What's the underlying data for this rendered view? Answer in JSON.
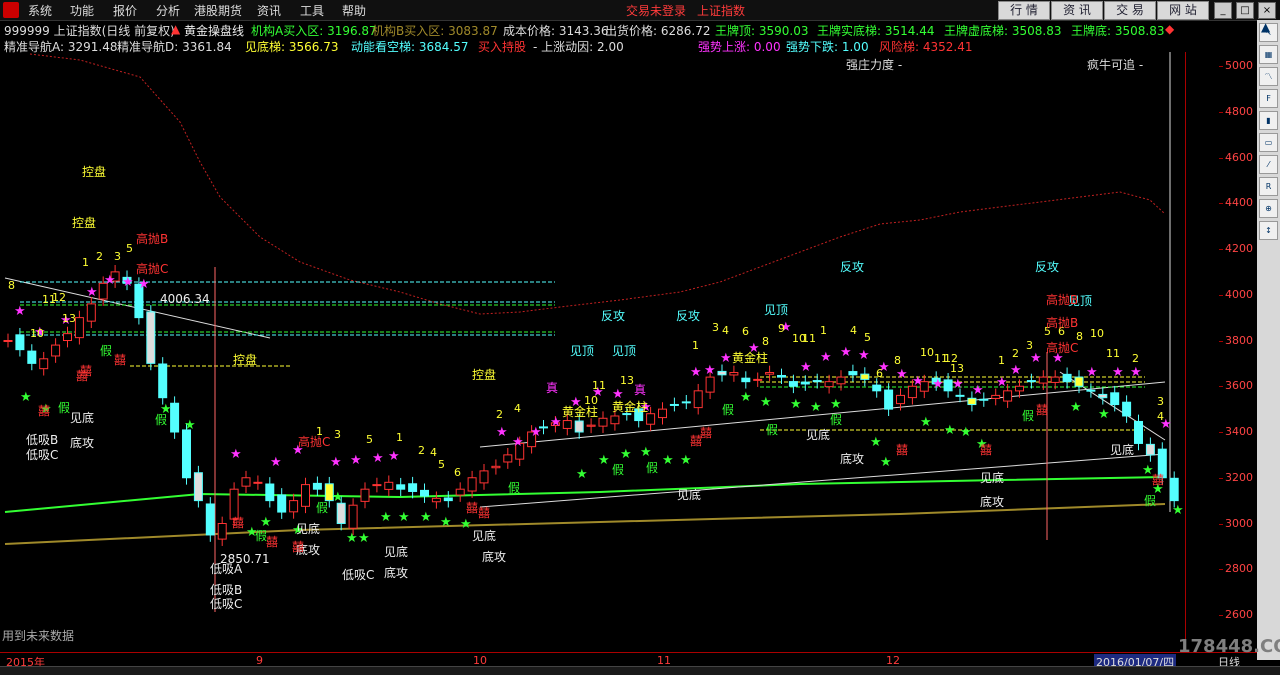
{
  "menu": {
    "items": [
      "系统",
      "功能",
      "报价",
      "分析",
      "港股期货",
      "资讯",
      "工具",
      "帮助"
    ],
    "login_status": "交易未登录",
    "index_name": "上证指数"
  },
  "toolbar_buttons": [
    "行 情",
    "资 讯",
    "交 易",
    "网 站"
  ],
  "header1": {
    "code": "999999 上证指数(日线 前复权)",
    "indicator": "黄金操盘线",
    "inst_a": "机构A买入区: 3196.87",
    "inst_b": "机构B买入区: 3083.87",
    "cost": "成本价格: 3143.36",
    "ship": "出货价格: 6286.72",
    "king_top": "王牌顶: 3590.03",
    "king_real": "王牌实底梯: 3514.44",
    "king_virtual": "王牌虚底梯: 3508.83",
    "king_bottom": "王牌底: 3508.83"
  },
  "header2": {
    "nav_a": "精准导航A: 3291.48",
    "nav_d": "精准导航D: 3361.84",
    "see_bottom": "见底梯: 3566.73",
    "momentum": "动能看空梯: 3684.57",
    "buy_hold": "买入持股",
    "up_factor": "- 上涨动因: 2.00",
    "strong_up": "强势上涨: 0.00",
    "strong_down": "强势下跌: 1.00",
    "risk": "风险梯: 4352.41",
    "strong_force": "强庄力度  -",
    "crazy_bull": "疯牛可追  -"
  },
  "y_axis": [
    "5000",
    "4800",
    "4600",
    "4400",
    "4200",
    "4000",
    "3800",
    "3600",
    "3400",
    "3200",
    "3000",
    "2800",
    "2600"
  ],
  "x_axis": {
    "labels": [
      "2015年",
      "9",
      "10",
      "11",
      "12"
    ],
    "date": "2016/01/07/四",
    "period": "日线"
  },
  "footer_note": "用到未来数据",
  "watermark": "178448.COM",
  "chart_labels": {
    "kongpan": "控盘",
    "low_a": "低吸A",
    "low_b": "低吸B",
    "low_c": "低吸C",
    "see_bottom": "见底",
    "bottom_attack": "底攻",
    "counter_attack": "反攻",
    "see_top": "见顶",
    "high_b": "高抛B",
    "high_c": "高抛C",
    "gold_pillar": "黄金柱",
    "fake": "假",
    "true": "真",
    "val_4006": "4006.34",
    "val_2850": "2850.71"
  },
  "colors": {
    "up": "#ff3333",
    "down": "#54ffff",
    "green_line": "#33ff33",
    "olive_line": "#a08a2a",
    "risk_line": "#c02020",
    "yellow": "#ffff33",
    "magenta": "#ff33ff"
  },
  "tool_icons": [
    "cursor-icon",
    "grid-icon",
    "chart-icon",
    "f10-icon",
    "candle-icon",
    "bar-icon",
    "line-icon",
    "rsi-icon",
    "zoom-icon",
    "arrow-icon"
  ]
}
